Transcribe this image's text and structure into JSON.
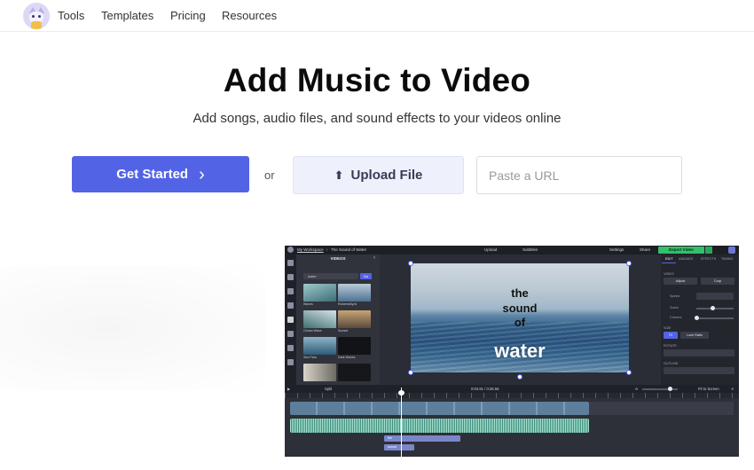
{
  "nav": {
    "logo_icon": "cat-mascot-icon",
    "links": [
      "Tools",
      "Templates",
      "Pricing",
      "Resources"
    ]
  },
  "hero": {
    "title": "Add Music to Video",
    "subtitle": "Add songs, audio files, and sound effects to your videos online",
    "get_started": "Get Started",
    "or": "or",
    "upload": "Upload File",
    "url_placeholder": "Paste a URL",
    "accent": "#5363e6"
  },
  "editor": {
    "breadcrumb": "My Workspace",
    "project": "The Sound of Water",
    "upload": "Upload",
    "subtitles": "Subtitles",
    "settings": "Settings",
    "share": "Share",
    "export": "Export Video",
    "library_title": "VIDEOS",
    "search_value": "water",
    "search_button": "Go",
    "thumbs": [
      "Waves",
      "RobertoMy/A",
      "Ocean Wave",
      "Sunset",
      "Sea Flow",
      "Dark Waves"
    ],
    "video_text": [
      "the",
      "sound",
      "of",
      "water"
    ],
    "prop_tabs": [
      "EDIT",
      "ANIMATE",
      "EFFECTS",
      "TIMING"
    ],
    "prop_labels": {
      "video": "VIDEO",
      "adjust": "Adjust",
      "crop": "Crop",
      "speed": "Speed",
      "zoom": "Zoom",
      "corners": "Corners",
      "size": "SIZE",
      "fit": "Fit",
      "lock": "Lock Ratio",
      "rotate": "ROTATE",
      "outline": "OUTLINE"
    },
    "toolbar": {
      "split": "Split",
      "time": "0:03.81 / 0:28.56",
      "fit": "Fit to Screen"
    },
    "text_clips": [
      "the",
      "sound"
    ]
  }
}
